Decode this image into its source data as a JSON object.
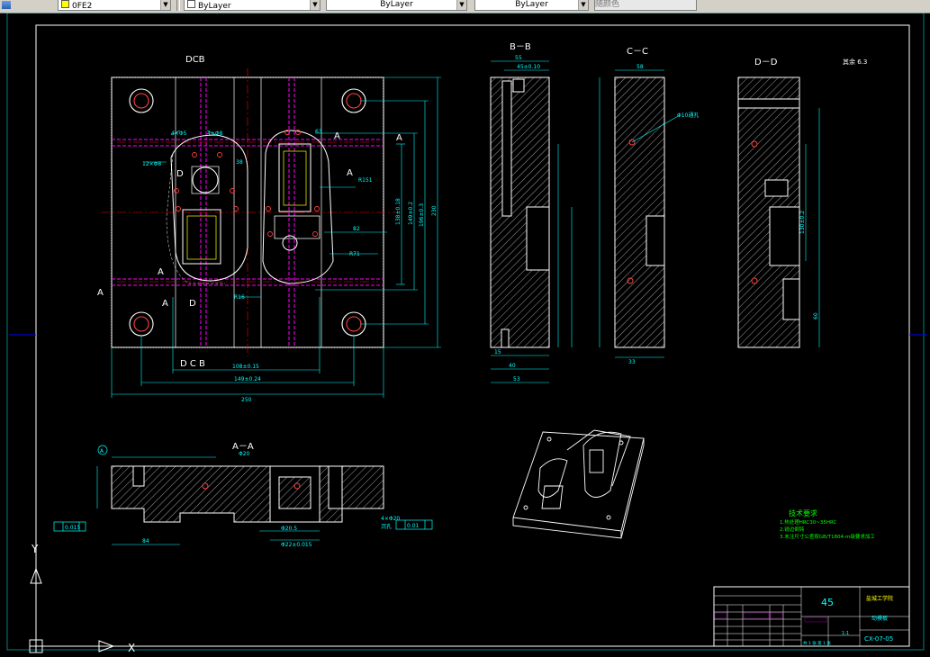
{
  "toolbar": {
    "layer_field": "0FE2",
    "color_field": "ByLayer",
    "linetype_field": "ByLayer",
    "lineweight_field": "ByLayer",
    "plotstyle_field": "随颜色"
  },
  "drawing": {
    "views": {
      "main_section_top": "DCB",
      "main_section_bottom": "D C B",
      "section_bb": "B－B",
      "section_cc": "C－C",
      "section_dd": "D－D",
      "section_aa": "A－A"
    },
    "roughness_note": "其余 6.3",
    "section_marks": {
      "a": "A",
      "b": "B",
      "c": "C",
      "d": "D"
    },
    "main_dims": {
      "overall_width": "250",
      "width_2": "149±0.24",
      "width_3": "108±0.15",
      "height_total": "230",
      "height_1": "196±0.3",
      "height_2": "149±0.2",
      "height_3": "138±0.18",
      "r_151": "R151",
      "r_71": "R71",
      "r_16": "R16",
      "d_12": "12×Φ8",
      "d_4": "4×Φ8",
      "d_5": "4×Φ5",
      "d_38": "38",
      "d_63": "63",
      "d_82": "82"
    },
    "bb_dims": {
      "top": "55",
      "top2": "45±0.10",
      "bot1": "15",
      "bot2": "40",
      "bot3": "53"
    },
    "cc_dims": {
      "top": "58",
      "bot": "33",
      "hole": "Φ10通孔"
    },
    "dd_dims": {
      "right1": "130±0.2",
      "right2": "60"
    },
    "aa_dims": {
      "top": "Φ20",
      "bot1": "84",
      "bot2": "Φ22±0.015",
      "bot3": "Φ20.5",
      "note": "4×Φ20",
      "note2": "沉孔",
      "datum": "A",
      "tol_left": "0.015",
      "tol_right": "0.01"
    },
    "tech_req": {
      "title": "技术要求",
      "items": [
        "1.热处理HRC30~35HRC",
        "2.锐边倒钝",
        "3.未注尺寸公差按GB/T1804-m级要求加工",
        ""
      ]
    },
    "title_block": {
      "material": "45",
      "school": "盐城工学院",
      "part_name": "动模板",
      "drawing_no": "CX-07-05",
      "scale": "1:1",
      "sheet": "共 1 张 第 1 张"
    },
    "ucs": {
      "x": "X",
      "y": "Y"
    }
  },
  "colors": {
    "background": "#000000",
    "border": "#0000ff",
    "geometry": "#ffffff",
    "dimension": "#00ffff",
    "centerline": "#ff0000",
    "hidden": "#ff00ff",
    "hatch": "#c8c8c8",
    "text_yellow": "#ffff00",
    "text_green": "#00ff00"
  }
}
